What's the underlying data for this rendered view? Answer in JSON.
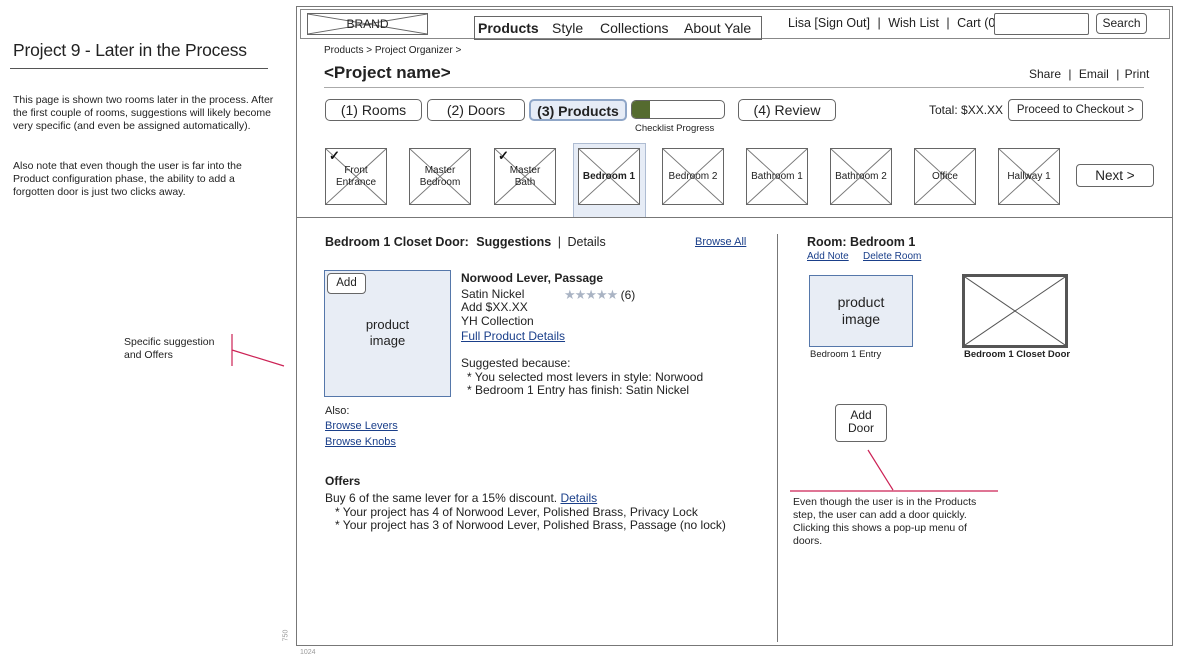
{
  "annotations": {
    "title": "Project 9 - Later in the Process",
    "para1": "This page is shown two rooms later in the process. After the first couple of rooms, suggestions will likely become very specific (and even be assigned automatically).",
    "para2": "Also note that even though the user is far into the Product configuration phase, the ability to add a forgotten door is just two clicks away.",
    "suggestion_note": "Specific suggestion and Offers",
    "add_door_note": "Even though the user is in the Products step, the user can add a door quickly. Clicking this shows a pop-up menu of doors.",
    "vertical_mark": "750",
    "bottom_mark": "1024",
    "accent_color": "#cc2255"
  },
  "header": {
    "brand": "BRAND",
    "nav": [
      "Products",
      "Style",
      "Collections",
      "About Yale"
    ],
    "user": "Lisa [Sign Out]",
    "wishlist": "Wish List",
    "cart": "Cart (0)",
    "search_placeholder": "",
    "search_button": "Search",
    "sep": "|"
  },
  "breadcrumb": "Products > Project Organizer >",
  "project_name": "<Project name>",
  "share": {
    "share": "Share",
    "email": "Email",
    "print": "Print"
  },
  "steps": {
    "rooms": "(1) Rooms",
    "doors": "(2) Doors",
    "products": "(3) Products",
    "review": "(4) Review",
    "checklist_label": "Checklist Progress",
    "progress": 0.2,
    "progress_color": "#556b2f"
  },
  "total": "Total: $XX.XX",
  "checkout": "Proceed to Checkout >",
  "rooms": [
    {
      "label": "Front Entrance",
      "checked": true
    },
    {
      "label": "Master Bedroom",
      "checked": false
    },
    {
      "label": "Master Bath",
      "checked": true
    },
    {
      "label": "Bedroom 1",
      "checked": false,
      "selected": true
    },
    {
      "label": "Bedroom 2",
      "checked": false
    },
    {
      "label": "Bathroom 1",
      "checked": false
    },
    {
      "label": "Bathroom 2",
      "checked": false
    },
    {
      "label": "Office",
      "checked": false
    },
    {
      "label": "Hallway 1",
      "checked": false
    }
  ],
  "next_button": "Next >",
  "left": {
    "heading": "Bedroom 1 Closet Door:",
    "tab_suggestions": "Suggestions",
    "tab_sep": "|",
    "tab_details": "Details",
    "browse_all": "Browse All",
    "add_button": "Add",
    "image_label": "product image",
    "product_name": "Norwood Lever, Passage",
    "finish": "Satin Nickel",
    "stars": "★★★★★",
    "rating_count": "(6)",
    "price": "Add $XX.XX",
    "collection": "YH Collection",
    "full_details": "Full Product Details",
    "suggested_because": "Suggested because:",
    "reasons": [
      "* You selected most levers in style: Norwood",
      "* Bedroom 1 Entry has finish: Satin Nickel"
    ],
    "also": "Also:",
    "browse_levers": "Browse Levers",
    "browse_knobs": "Browse Knobs",
    "offers_heading": "Offers",
    "offer_main": "Buy 6 of the same lever for a 15% discount.",
    "offer_details": "Details",
    "offer_lines": [
      "* Your project has 4 of Norwood Lever, Polished Brass, Privacy Lock",
      "* Your project has 3 of Norwood Lever, Polished Brass, Passage (no lock)"
    ]
  },
  "right": {
    "heading": "Room: Bedroom 1",
    "add_note": "Add Note",
    "delete_room": "Delete Room",
    "image_label": "product image",
    "entry_caption": "Bedroom 1 Entry",
    "closet_caption": "Bedroom 1 Closet Door",
    "add_door": "Add Door"
  }
}
